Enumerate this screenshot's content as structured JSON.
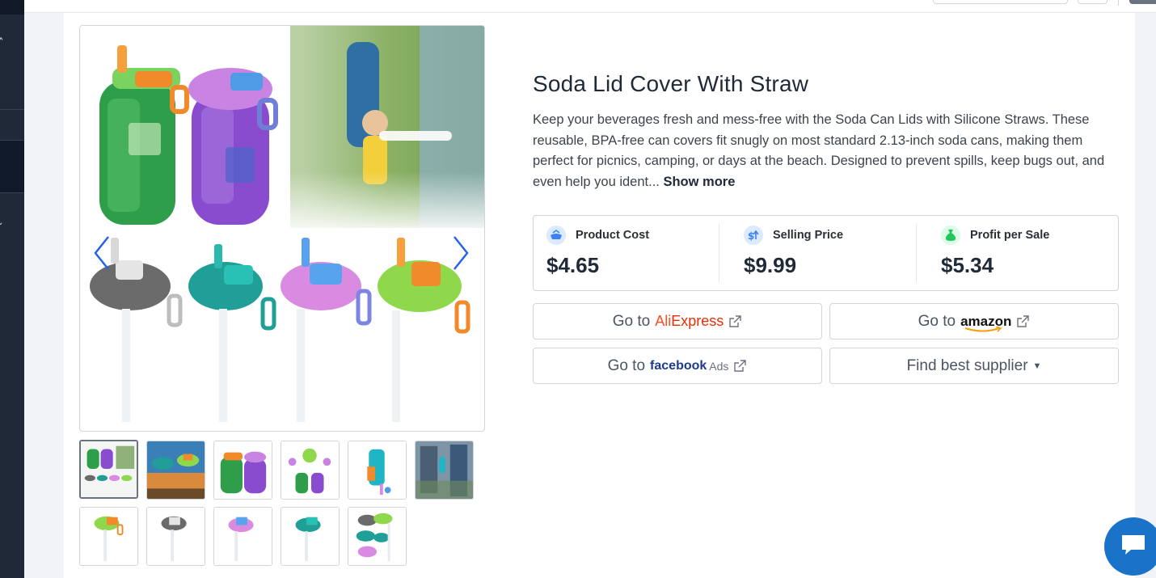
{
  "product": {
    "title": "Soda Lid Cover With Straw",
    "description": "Keep your beverages fresh and mess-free with the Soda Can Lids with Silicone Straws. These reusable, BPA-free can covers fit snugly on most standard 2.13-inch soda cans, making them perfect for picnics, camping, or days at the beach. Designed to prevent spills, keep bugs out, and even help you ident...",
    "show_more_label": "Show more"
  },
  "stats": {
    "product_cost": {
      "label": "Product Cost",
      "value": "$4.65",
      "icon": "box-icon",
      "icon_color": "#3b82f6"
    },
    "selling_price": {
      "label": "Selling Price",
      "value": "$9.99",
      "icon": "price-up-icon",
      "icon_color": "#3b82f6"
    },
    "profit": {
      "label": "Profit per Sale",
      "value": "$5.34",
      "icon": "money-bag-icon",
      "icon_color": "#22c55e"
    }
  },
  "buttons": {
    "go_to": "Go to",
    "aliexpress_a": "Ali",
    "aliexpress_b": "Express",
    "amazon": "amazon",
    "facebook": "facebook",
    "facebook_ads": "Ads",
    "find_supplier": "Find best supplier"
  },
  "gallery": {
    "thumbnail_count": 11,
    "active_index": 0,
    "icons": {
      "prev": "chevron-left-icon",
      "next": "chevron-right-icon"
    }
  },
  "colors": {
    "sidebar": "#1f2937",
    "accent_blue": "#1a73c8",
    "aliexpress": "#e62e04",
    "facebook": "#1d3b8e",
    "profit_green": "#22c55e"
  }
}
